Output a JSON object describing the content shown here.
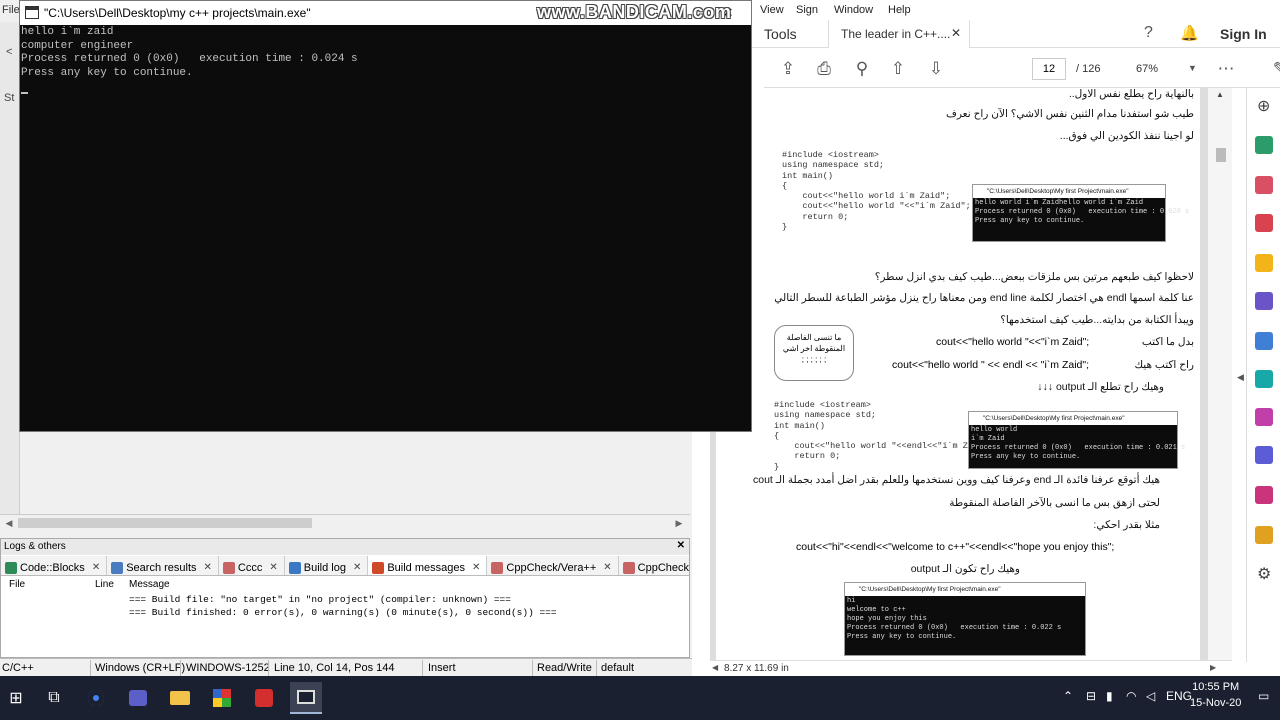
{
  "ide": {
    "menu_partial": "File",
    "side_partial_a": "<",
    "side_partial_b": "St",
    "logs_title": "Logs & others",
    "tabs": [
      {
        "label": "Code::Blocks",
        "color": "#2e8b57"
      },
      {
        "label": "Search results",
        "color": "#4a7bbf"
      },
      {
        "label": "Cccc",
        "color": "#c86464"
      },
      {
        "label": "Build log",
        "color": "#3b78c4"
      },
      {
        "label": "Build messages",
        "color": "#d04a2a"
      },
      {
        "label": "CppCheck/Vera++",
        "color": "#c86464"
      },
      {
        "label": "CppCheck/Vera",
        "color": "#c86464"
      }
    ],
    "log_headers": {
      "file": "File",
      "line": "Line",
      "message": "Message"
    },
    "log_rows": [
      "=== Build file: \"no target\" in \"no project\" (compiler: unknown) ===",
      "=== Build finished: 0 error(s), 0 warning(s) (0 minute(s), 0 second(s)) ==="
    ],
    "status": {
      "lang": "C/C++",
      "eol": "Windows (CR+LF)",
      "encoding": "WINDOWS-1252",
      "position": "Line 10, Col 14, Pos 144",
      "mode": "Insert",
      "rw": "Read/Write",
      "profile": "default"
    }
  },
  "console": {
    "title": "\"C:\\Users\\Dell\\Desktop\\my c++ projects\\main.exe\"",
    "lines": [
      "hello i`m zaid",
      "computer engineer",
      "Process returned 0 (0x0)   execution time : 0.024 s",
      "Press any key to continue."
    ],
    "minimize": "—",
    "maximize": "☐",
    "close": "✕"
  },
  "watermark": "www.BANDICAM.com",
  "pdf": {
    "menu": [
      "View",
      "Sign",
      "Window",
      "Help"
    ],
    "tools_tab": "Tools",
    "doc_tab": "The leader in C++....",
    "sign_in": "Sign In",
    "page_current": "12",
    "page_total": "/ 126",
    "zoom": "67%",
    "page_size": "8.27 x 11.69 in",
    "content": {
      "l1": "بالنهاية راح يطلع نفس الاول..",
      "l2": "طيب شو استفدنا مدام الثنين نفس الاشي؟ الآن راح نعرف",
      "l3": "لو اجينا ننفذ الكودين الي فوق...",
      "code1": "#include <iostream>\nusing namespace std;\nint main()\n{\n    cout<<\"hello world i`m Zaid\";\n    cout<<\"hello world \"<<\"i`m Zaid\";\n    return 0;\n}",
      "mini1_title": "\"C:\\Users\\Dell\\Desktop\\My first Project\\main.exe\"",
      "mini1_body": "hello world i`m Zaidhello world i`m Zaid\nProcess returned 0 (0x0)   execution time : 0.020 s\nPress any key to continue.",
      "l4": "لاحظوا كيف طبعهم مرتين بس ملزقات ببعض...طيب كيف بدي انزل سطر؟",
      "l5": "عنا كلمة اسمها endl هي اختصار لكلمة end line ومن معناها راح ينزل مؤشر الطباعة للسطر التالي",
      "l6": "ويبدأ الكتابة من بدايته...طيب كيف استخدمها؟",
      "l7a": "بدل ما اكتب",
      "l7b": "cout<<\"hello world \"<<\"i`m Zaid\";",
      "l8a": "راح اكتب هيك",
      "l8b": "cout<<\"hello world \" << endl << \"i`m Zaid\";",
      "l9": "وهيك راح تطلع الـ output ↓↓↓",
      "bubble": "ما تنسى الفاصلة المنقوطة اخر اشي\n; ; ; ; ; ;",
      "code2": "#include <iostream>\nusing namespace std;\nint main()\n{\n    cout<<\"hello world \"<<endl<<\"i`m Zaid\";\n    return 0;\n}",
      "mini2_title": "\"C:\\Users\\Dell\\Desktop\\My first Project\\main.exe\"",
      "mini2_body": "hello world\ni`m Zaid\nProcess returned 0 (0x0)   execution time : 0.021 s\nPress any key to continue.",
      "l10": "هيك أتوقع عرفنا فائدة الـ end وعرفنا كيف ووين نستخدمها وللعلم بقدر اضل أمدد بجملة الـ cout",
      "l11": "لحتى ازهق بس ما انسى بالآخر الفاصلة المنقوطة",
      "l12": "مثلا بقدر احكي:",
      "l13": "cout<<\"hi\"<<endl<<\"welcome to c++\"<<endl<<\"hope you enjoy this\";",
      "l14": "وهيك راح تكون الـ output",
      "mini3_title": "\"C:\\Users\\Dell\\Desktop\\My first Project\\main.exe\"",
      "mini3_body": "hi\nwelcome to c++\nhope you enjoy this\nProcess returned 0 (0x0)   execution time : 0.022 s\nPress any key to continue."
    }
  },
  "taskbar": {
    "lang": "ENG",
    "time": "10:55 PM",
    "date": "15-Nov-20"
  }
}
